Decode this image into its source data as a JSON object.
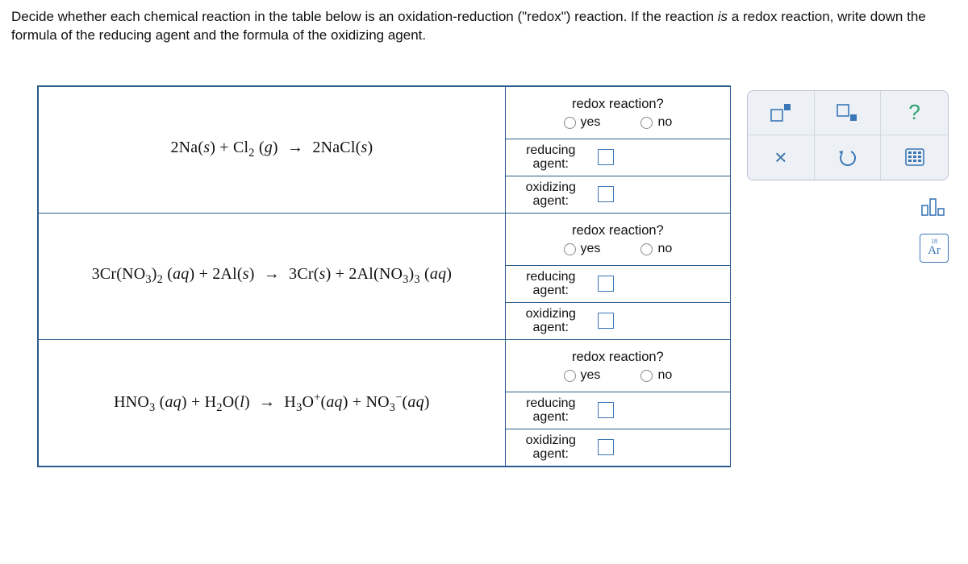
{
  "instructions": {
    "part1": "Decide whether each chemical reaction in the table below is an oxidation-reduction (\"redox\") reaction. If the reaction ",
    "part2_italic": "is",
    "part3": " a redox reaction, write down the formula of the reducing agent and the formula of the oxidizing agent."
  },
  "labels": {
    "redox_q": "redox reaction?",
    "yes": "yes",
    "no": "no",
    "reducing": "reducing agent:",
    "oxidizing": "oxidizing agent:"
  },
  "reactions": [
    {
      "html": "2Na(<i>s</i>) + Cl<sub>2</sub> (<i>g</i>) <span class='arrow'>→</span> 2NaCl(<i>s</i>)"
    },
    {
      "html": "3Cr(NO<sub>3</sub>)<sub>2</sub> (<i>aq</i>) + 2Al(<i>s</i>) <span class='arrow'>→</span> 3Cr(<i>s</i>) + 2Al(NO<sub>3</sub>)<sub>3</sub> (<i>aq</i>)"
    },
    {
      "html": "HNO<sub>3</sub> (<i>aq</i>) + H<sub>2</sub>O(<i>l</i>) <span class='arrow'>→</span> H<sub>3</sub>O<sup>+</sup>(<i>aq</i>) + NO<sub>3</sub><sup>−</sup>(<i>aq</i>)"
    }
  ],
  "palette": {
    "help": "?",
    "close": "×",
    "ar_top": "18",
    "ar_main": "Ar"
  }
}
